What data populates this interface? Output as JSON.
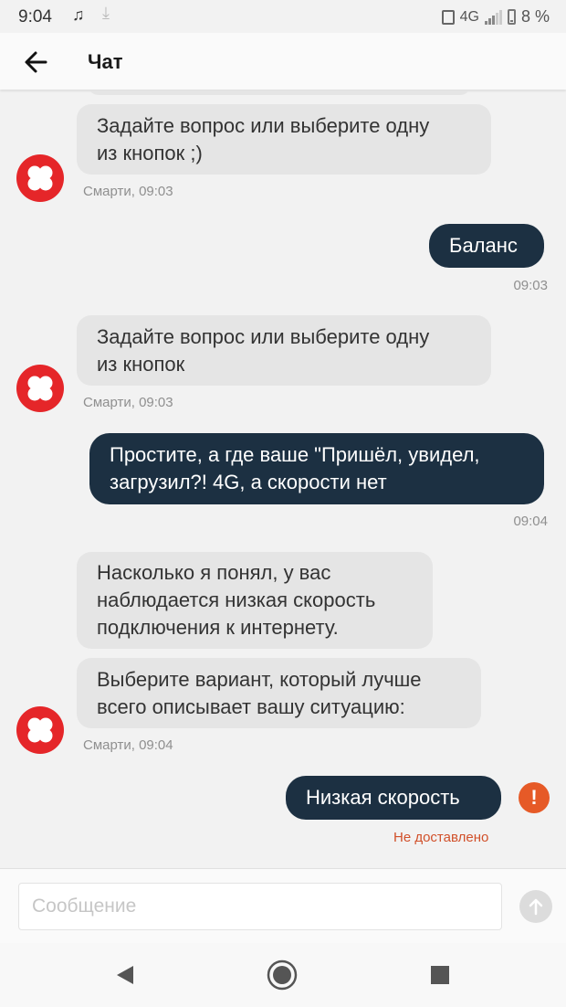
{
  "status_bar": {
    "time": "9:04",
    "network": "4G",
    "battery": "8 %",
    "icons": [
      "music-note-icon",
      "download-icon",
      "vibrate-icon",
      "signal-icon",
      "battery-icon"
    ]
  },
  "header": {
    "title": "Чат",
    "back_icon": "arrow-left-icon"
  },
  "messages": [
    {
      "sender": "bot",
      "lines": [
        "Задайте вопрос или выберите одну",
        "из кнопок ;)"
      ],
      "meta": "Смарти, 09:03"
    },
    {
      "sender": "user",
      "lines": [
        "Баланс"
      ],
      "meta": "09:03"
    },
    {
      "sender": "bot",
      "lines": [
        "Задайте вопрос или выберите одну",
        "из кнопок"
      ],
      "meta": "Смарти, 09:03"
    },
    {
      "sender": "user",
      "lines": [
        "Простите, а где ваше \"Пришёл, увидел,",
        "загрузил?! 4G, а скорости нет"
      ],
      "meta": "09:04"
    },
    {
      "sender": "bot",
      "lines": [
        "Насколько я понял, у вас",
        "наблюдается низкая скорость",
        "подключения к интернету."
      ]
    },
    {
      "sender": "bot",
      "lines": [
        "Выберите вариант, который лучше",
        "всего описывает вашу ситуацию:"
      ],
      "meta": "Смарти, 09:04"
    },
    {
      "sender": "user",
      "lines": [
        "Низкая скорость"
      ],
      "status": "Не доставлено",
      "error_icon": "!"
    }
  ],
  "composer": {
    "placeholder": "Сообщение",
    "value": "",
    "send_icon": "arrow-up-icon"
  },
  "colors": {
    "user_bubble": "#1c3042",
    "bot_bubble": "#e5e5e5",
    "brand_red": "#e52629",
    "error": "#e65a27"
  }
}
